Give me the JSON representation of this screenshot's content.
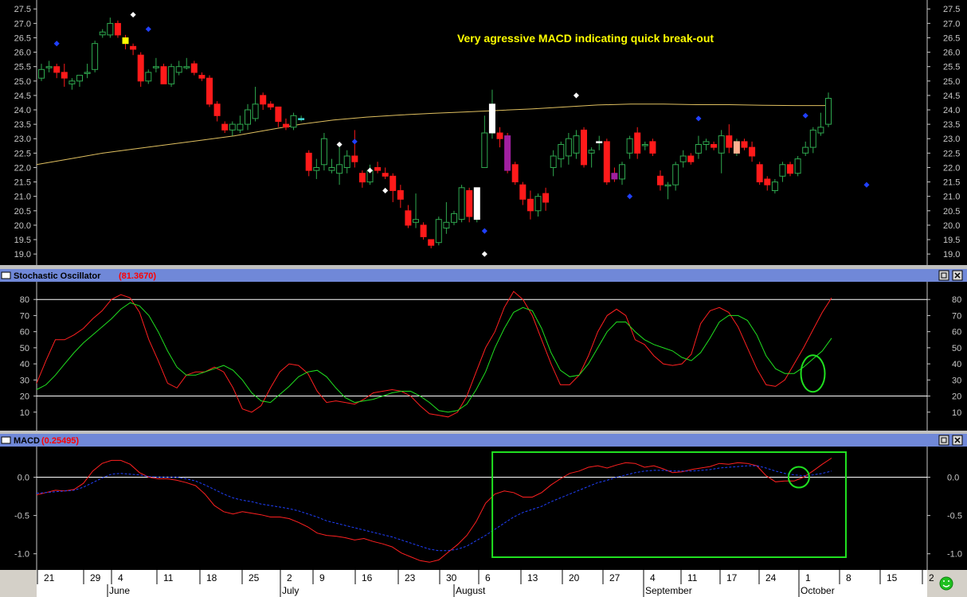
{
  "colors": {
    "background": "#000000",
    "bull": "#2fa84f",
    "bear": "#ff1a1a",
    "ma_line": "#e0c060",
    "stoch_k": "#ff2020",
    "stoch_d": "#20e020",
    "macd_line": "#ff2020",
    "signal_line": "#2040ff",
    "highlight": "#20e020",
    "annotation": "#ffff00",
    "title_bar": "#7088d8",
    "axis_text": "#000000"
  },
  "annotation": "Very agressive MACD indicating quick break-out",
  "x_axis": {
    "day_labels": [
      "21",
      "29",
      "4",
      "11",
      "18",
      "25",
      "2",
      "9",
      "16",
      "23",
      "30",
      "6",
      "13",
      "20",
      "27",
      "4",
      "11",
      "17",
      "24",
      "1",
      "8",
      "15",
      "2"
    ],
    "month_labels": [
      "June",
      "July",
      "August",
      "September",
      "October"
    ]
  },
  "price_panel": {
    "y_ticks": [
      "27.5",
      "27.0",
      "26.5",
      "26.0",
      "25.5",
      "25.0",
      "24.5",
      "24.0",
      "23.5",
      "23.0",
      "22.5",
      "22.0",
      "21.5",
      "21.0",
      "20.5",
      "20.0",
      "19.5",
      "19.0"
    ]
  },
  "stoch_panel": {
    "title": "Stochastic Oscillator",
    "value": "(81.3670)",
    "y_ticks": [
      "80",
      "70",
      "60",
      "50",
      "40",
      "30",
      "20",
      "10"
    ]
  },
  "macd_panel": {
    "title": "MACD",
    "value": "(0.25495)",
    "y_ticks": [
      "0.0",
      "-0.5",
      "-1.0"
    ]
  },
  "chart_data": [
    {
      "type": "candlestick",
      "ylim": [
        18.7,
        27.7
      ],
      "moving_average": [
        22.1,
        22.3,
        22.5,
        22.65,
        22.8,
        22.95,
        23.1,
        23.3,
        23.5,
        23.65,
        23.75,
        23.82,
        23.88,
        23.93,
        23.98,
        24.03,
        24.1,
        24.17,
        24.2,
        24.2,
        24.18,
        24.18,
        24.16,
        24.15,
        24.15
      ],
      "candles": [
        [
          25.1,
          25.4,
          25.6,
          25.0
        ],
        [
          25.5,
          25.5,
          25.7,
          25.3
        ],
        [
          25.5,
          25.3,
          25.6,
          25.1
        ],
        [
          25.3,
          25.1,
          25.6,
          24.8
        ],
        [
          24.9,
          25.0,
          25.1,
          24.7
        ],
        [
          25.0,
          25.2,
          25.2,
          24.8
        ],
        [
          25.3,
          25.3,
          25.6,
          25.1
        ],
        [
          25.4,
          26.3,
          26.4,
          25.3
        ],
        [
          26.6,
          26.7,
          26.8,
          26.5
        ],
        [
          26.6,
          27.0,
          27.2,
          26.5
        ],
        [
          27.0,
          26.6,
          27.1,
          26.5
        ],
        [
          26.5,
          26.3,
          26.6,
          26.1
        ],
        [
          26.2,
          26.1,
          26.3,
          25.9
        ],
        [
          25.9,
          25.0,
          26.0,
          24.8
        ],
        [
          25.0,
          25.3,
          25.4,
          24.9
        ],
        [
          25.5,
          25.5,
          25.8,
          25.3
        ],
        [
          25.5,
          24.9,
          25.6,
          24.9
        ],
        [
          24.9,
          25.5,
          25.6,
          24.8
        ],
        [
          25.3,
          25.5,
          25.7,
          25.2
        ],
        [
          25.5,
          25.5,
          25.8,
          25.4
        ],
        [
          25.6,
          25.3,
          25.7,
          25.2
        ],
        [
          25.2,
          25.1,
          25.3,
          25.0
        ],
        [
          25.1,
          24.2,
          25.2,
          24.1
        ],
        [
          24.2,
          23.8,
          24.3,
          23.6
        ],
        [
          23.5,
          23.3,
          23.6,
          23.2
        ],
        [
          23.3,
          23.5,
          23.6,
          23.1
        ],
        [
          23.3,
          23.5,
          23.8,
          23.2
        ],
        [
          23.5,
          24.0,
          24.2,
          23.3
        ],
        [
          23.7,
          24.2,
          24.8,
          23.6
        ],
        [
          24.5,
          24.2,
          24.6,
          24.0
        ],
        [
          24.2,
          24.1,
          24.3,
          24.0
        ],
        [
          24.1,
          23.6,
          24.1,
          23.4
        ],
        [
          23.5,
          23.4,
          23.7,
          23.3
        ],
        [
          23.4,
          23.8,
          23.9,
          23.3
        ],
        [
          23.7,
          23.7,
          23.8,
          23.6
        ],
        [
          22.5,
          21.9,
          22.6,
          21.7
        ],
        [
          21.9,
          22.0,
          22.3,
          21.6
        ],
        [
          22.1,
          23.0,
          23.2,
          21.9
        ],
        [
          21.9,
          22.0,
          22.3,
          21.8
        ],
        [
          21.8,
          22.1,
          22.7,
          21.4
        ],
        [
          22.0,
          22.4,
          22.6,
          21.8
        ],
        [
          22.4,
          22.2,
          23.3,
          22.0
        ],
        [
          21.8,
          21.5,
          21.9,
          21.3
        ],
        [
          21.5,
          21.9,
          22.1,
          21.4
        ],
        [
          22.0,
          21.9,
          22.2,
          21.8
        ],
        [
          21.8,
          21.7,
          22.0,
          21.6
        ],
        [
          21.7,
          21.2,
          21.8,
          20.8
        ],
        [
          21.2,
          20.9,
          21.4,
          20.6
        ],
        [
          20.5,
          20.0,
          20.7,
          19.9
        ],
        [
          20.1,
          20.2,
          21.1,
          19.9
        ],
        [
          20.0,
          19.6,
          20.1,
          19.5
        ],
        [
          19.5,
          19.3,
          19.5,
          19.2
        ],
        [
          19.4,
          20.2,
          20.3,
          19.3
        ],
        [
          19.9,
          20.1,
          20.8,
          19.7
        ],
        [
          20.1,
          20.4,
          20.5,
          20.0
        ],
        [
          20.2,
          21.3,
          21.4,
          20.1
        ],
        [
          21.2,
          20.3,
          21.3,
          20.1
        ],
        [
          20.2,
          21.3,
          21.3,
          20.1
        ],
        [
          22.0,
          23.2,
          23.8,
          22.1
        ],
        [
          23.2,
          24.2,
          24.7,
          23.0
        ],
        [
          23.2,
          23.0,
          23.4,
          22.7
        ],
        [
          23.1,
          21.9,
          23.2,
          21.8
        ],
        [
          22.1,
          21.5,
          22.2,
          21.4
        ],
        [
          21.4,
          20.9,
          21.5,
          20.7
        ],
        [
          20.9,
          20.5,
          21.2,
          20.2
        ],
        [
          20.5,
          21.0,
          21.1,
          20.3
        ],
        [
          21.1,
          20.8,
          21.3,
          20.5
        ],
        [
          22.0,
          22.4,
          22.6,
          21.7
        ],
        [
          22.3,
          22.8,
          22.9,
          22.0
        ],
        [
          22.4,
          23.0,
          23.2,
          22.1
        ],
        [
          22.5,
          23.1,
          23.3,
          22.3
        ],
        [
          23.3,
          22.1,
          23.4,
          22.0
        ],
        [
          22.5,
          22.6,
          22.7,
          22.0
        ],
        [
          22.9,
          22.9,
          23.1,
          22.6
        ],
        [
          22.9,
          21.5,
          23.0,
          21.4
        ],
        [
          21.8,
          21.6,
          22.0,
          21.5
        ],
        [
          21.6,
          22.1,
          22.2,
          21.4
        ],
        [
          22.5,
          23.0,
          23.1,
          22.3
        ],
        [
          23.2,
          22.5,
          23.4,
          22.3
        ],
        [
          22.8,
          22.8,
          22.9,
          22.6
        ],
        [
          22.9,
          22.5,
          23.0,
          22.4
        ],
        [
          21.7,
          21.4,
          21.9,
          21.2
        ],
        [
          21.4,
          21.4,
          21.5,
          20.9
        ],
        [
          21.4,
          22.1,
          22.2,
          21.2
        ],
        [
          22.2,
          22.4,
          22.6,
          22.0
        ],
        [
          22.4,
          22.2,
          22.5,
          22.1
        ],
        [
          22.5,
          22.8,
          23.1,
          22.3
        ],
        [
          22.8,
          22.9,
          23.0,
          22.6
        ],
        [
          22.8,
          22.7,
          22.9,
          22.6
        ],
        [
          22.5,
          23.1,
          23.3,
          21.8
        ],
        [
          23.1,
          22.7,
          23.5,
          22.5
        ],
        [
          22.5,
          22.9,
          23.0,
          22.4
        ],
        [
          22.9,
          22.7,
          23.0,
          22.6
        ],
        [
          22.7,
          22.4,
          22.9,
          22.2
        ],
        [
          22.1,
          21.5,
          22.2,
          21.4
        ],
        [
          21.6,
          21.4,
          21.7,
          21.2
        ],
        [
          21.2,
          21.5,
          21.6,
          21.1
        ],
        [
          21.7,
          22.1,
          22.2,
          21.5
        ],
        [
          22.1,
          21.8,
          22.2,
          21.7
        ],
        [
          21.8,
          22.3,
          22.4,
          21.7
        ],
        [
          22.5,
          22.7,
          22.9,
          22.4
        ],
        [
          22.7,
          23.3,
          23.4,
          22.5
        ],
        [
          23.2,
          23.4,
          23.9,
          23.1
        ],
        [
          23.5,
          24.4,
          24.6,
          23.4
        ]
      ],
      "markers_white": [
        [
          12,
          27.3
        ],
        [
          39,
          22.8
        ],
        [
          43,
          21.9
        ],
        [
          45,
          21.2
        ],
        [
          58,
          19.0
        ],
        [
          70,
          24.5
        ]
      ],
      "markers_blue": [
        [
          2,
          26.3
        ],
        [
          14,
          26.8
        ],
        [
          41,
          22.9
        ],
        [
          58,
          19.8
        ],
        [
          77,
          21.0
        ],
        [
          86,
          23.7
        ],
        [
          100,
          23.8
        ],
        [
          108,
          21.4
        ]
      ]
    },
    {
      "type": "line",
      "ylim": [
        0,
        90
      ],
      "reference_lines": [
        80,
        20
      ],
      "series": [
        {
          "values": [
            28,
            42,
            55,
            55,
            58,
            62,
            68,
            73,
            80,
            83,
            81,
            72,
            55,
            42,
            28,
            25,
            33,
            35,
            35,
            38,
            35,
            25,
            12,
            10,
            14,
            25,
            35,
            40,
            39,
            34,
            23,
            16,
            17,
            16,
            15,
            18,
            22,
            23,
            24,
            23,
            20,
            14,
            9,
            8,
            7,
            10,
            20,
            35,
            50,
            60,
            75,
            85,
            80,
            70,
            55,
            40,
            27,
            27,
            33,
            45,
            60,
            70,
            74,
            70,
            55,
            52,
            45,
            40,
            39,
            40,
            46,
            65,
            73,
            75,
            72,
            63,
            50,
            37,
            27,
            26,
            30,
            40,
            50,
            61,
            72,
            81
          ]
        },
        {
          "values": [
            24,
            27,
            33,
            40,
            47,
            53,
            58,
            63,
            68,
            74,
            78,
            76,
            70,
            60,
            48,
            38,
            33,
            33,
            35,
            37,
            39,
            36,
            30,
            22,
            17,
            16,
            21,
            26,
            32,
            35,
            36,
            32,
            25,
            19,
            16,
            17,
            18,
            20,
            22,
            23,
            23,
            20,
            16,
            11,
            10,
            11,
            15,
            24,
            35,
            50,
            62,
            72,
            75,
            73,
            62,
            47,
            36,
            32,
            33,
            40,
            50,
            60,
            66,
            66,
            60,
            55,
            52,
            50,
            48,
            44,
            42,
            47,
            56,
            66,
            70,
            70,
            67,
            58,
            45,
            37,
            34,
            34,
            38,
            43,
            48,
            56
          ]
        }
      ],
      "highlight_ellipse": {
        "x": 83,
        "y": 34
      }
    },
    {
      "type": "line",
      "ylim": [
        -1.18,
        0.38
      ],
      "reference_lines": [
        0
      ],
      "series": [
        {
          "values": [
            -0.23,
            -0.2,
            -0.17,
            -0.18,
            -0.16,
            -0.08,
            0.08,
            0.18,
            0.22,
            0.22,
            0.17,
            0.06,
            0.0,
            -0.02,
            -0.02,
            -0.04,
            -0.07,
            -0.11,
            -0.22,
            -0.37,
            -0.45,
            -0.48,
            -0.45,
            -0.47,
            -0.49,
            -0.52,
            -0.52,
            -0.54,
            -0.59,
            -0.65,
            -0.73,
            -0.76,
            -0.77,
            -0.79,
            -0.82,
            -0.8,
            -0.84,
            -0.87,
            -0.91,
            -0.99,
            -1.04,
            -1.09,
            -1.11,
            -1.08,
            -0.98,
            -0.88,
            -0.76,
            -0.58,
            -0.34,
            -0.22,
            -0.18,
            -0.2,
            -0.26,
            -0.26,
            -0.2,
            -0.1,
            -0.02,
            0.05,
            0.08,
            0.13,
            0.15,
            0.12,
            0.16,
            0.19,
            0.18,
            0.13,
            0.15,
            0.11,
            0.06,
            0.07,
            0.1,
            0.12,
            0.14,
            0.18,
            0.17,
            0.19,
            0.18,
            0.15,
            0.02,
            -0.06,
            -0.05,
            -0.05,
            0.0,
            0.08,
            0.17,
            0.25
          ]
        },
        {
          "values": [
            -0.21,
            -0.2,
            -0.19,
            -0.18,
            -0.17,
            -0.13,
            -0.07,
            -0.01,
            0.04,
            0.05,
            0.04,
            0.03,
            0.01,
            0.0,
            0.0,
            0.0,
            -0.02,
            -0.05,
            -0.1,
            -0.16,
            -0.22,
            -0.27,
            -0.3,
            -0.32,
            -0.35,
            -0.37,
            -0.39,
            -0.41,
            -0.44,
            -0.48,
            -0.52,
            -0.57,
            -0.6,
            -0.63,
            -0.66,
            -0.69,
            -0.72,
            -0.75,
            -0.78,
            -0.82,
            -0.86,
            -0.9,
            -0.94,
            -0.96,
            -0.96,
            -0.94,
            -0.9,
            -0.83,
            -0.76,
            -0.68,
            -0.6,
            -0.52,
            -0.46,
            -0.42,
            -0.38,
            -0.32,
            -0.27,
            -0.22,
            -0.17,
            -0.12,
            -0.07,
            -0.04,
            0.0,
            0.03,
            0.06,
            0.08,
            0.09,
            0.09,
            0.08,
            0.08,
            0.08,
            0.09,
            0.1,
            0.12,
            0.13,
            0.14,
            0.15,
            0.15,
            0.12,
            0.08,
            0.05,
            0.03,
            0.02,
            0.03,
            0.05,
            0.08
          ]
        }
      ],
      "highlight_box": {
        "x0": 46,
        "x1": 85
      },
      "highlight_circle": {
        "x": 81.5,
        "y": 0.0
      }
    }
  ]
}
